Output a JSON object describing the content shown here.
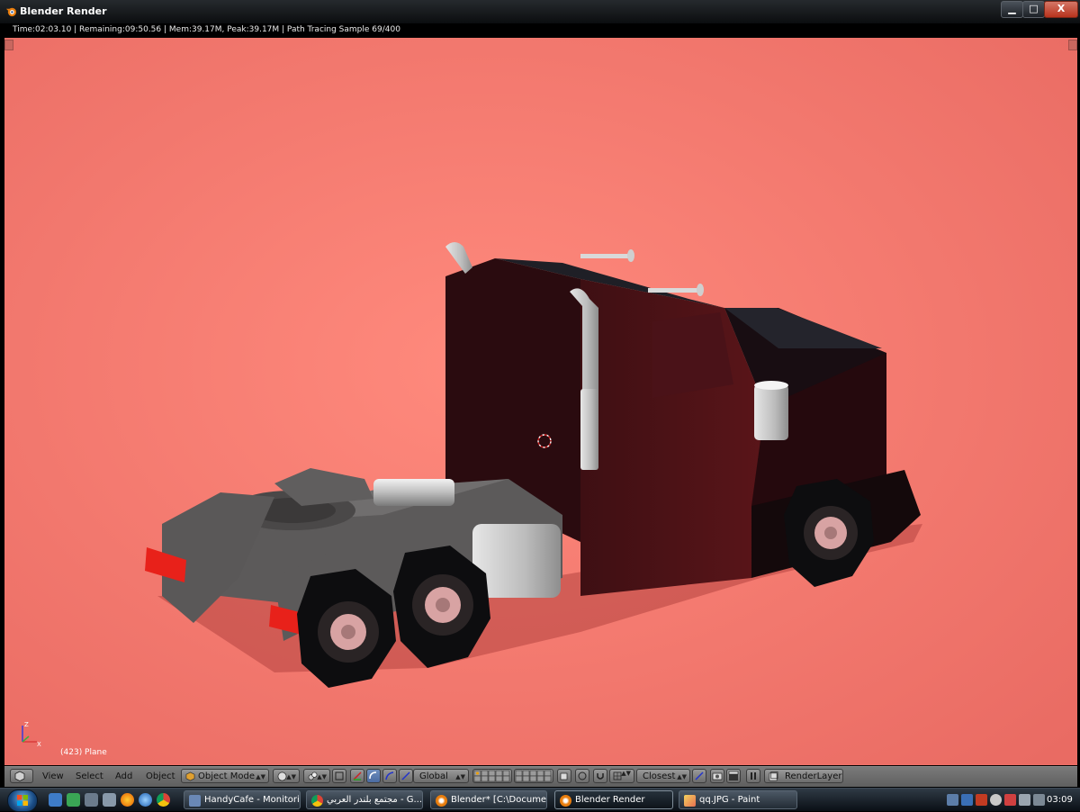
{
  "window": {
    "title": "Blender Render",
    "controls": {
      "minimize": "▁",
      "maximize": "□",
      "close": "X"
    }
  },
  "render_status": {
    "text": "Time:02:03.10 | Remaining:09:50.56 | Mem:39.17M, Peak:39.17M | Path Tracing Sample 69/400"
  },
  "viewport": {
    "object_label": "(423) Plane",
    "background_color": "#f1796d",
    "axes": {
      "z": "Z",
      "x": "X"
    }
  },
  "header": {
    "menus": [
      "View",
      "Select",
      "Add",
      "Object"
    ],
    "mode": "Object Mode",
    "orientation": "Global",
    "snap_target": "Closest",
    "render_layer": "RenderLayer"
  },
  "taskbar": {
    "tasks": [
      {
        "label": "HandyCafe - Monitoring",
        "icon": "monitor-icon"
      },
      {
        "label": "مجتمع بلندر العربي - G...",
        "icon": "chrome-icon"
      },
      {
        "label": "Blender* [C:\\Documen...",
        "icon": "blender-icon"
      },
      {
        "label": "Blender Render",
        "icon": "blender-icon",
        "active": true
      },
      {
        "label": "qq.JPG - Paint",
        "icon": "paint-icon"
      }
    ],
    "clock": "03:09"
  }
}
